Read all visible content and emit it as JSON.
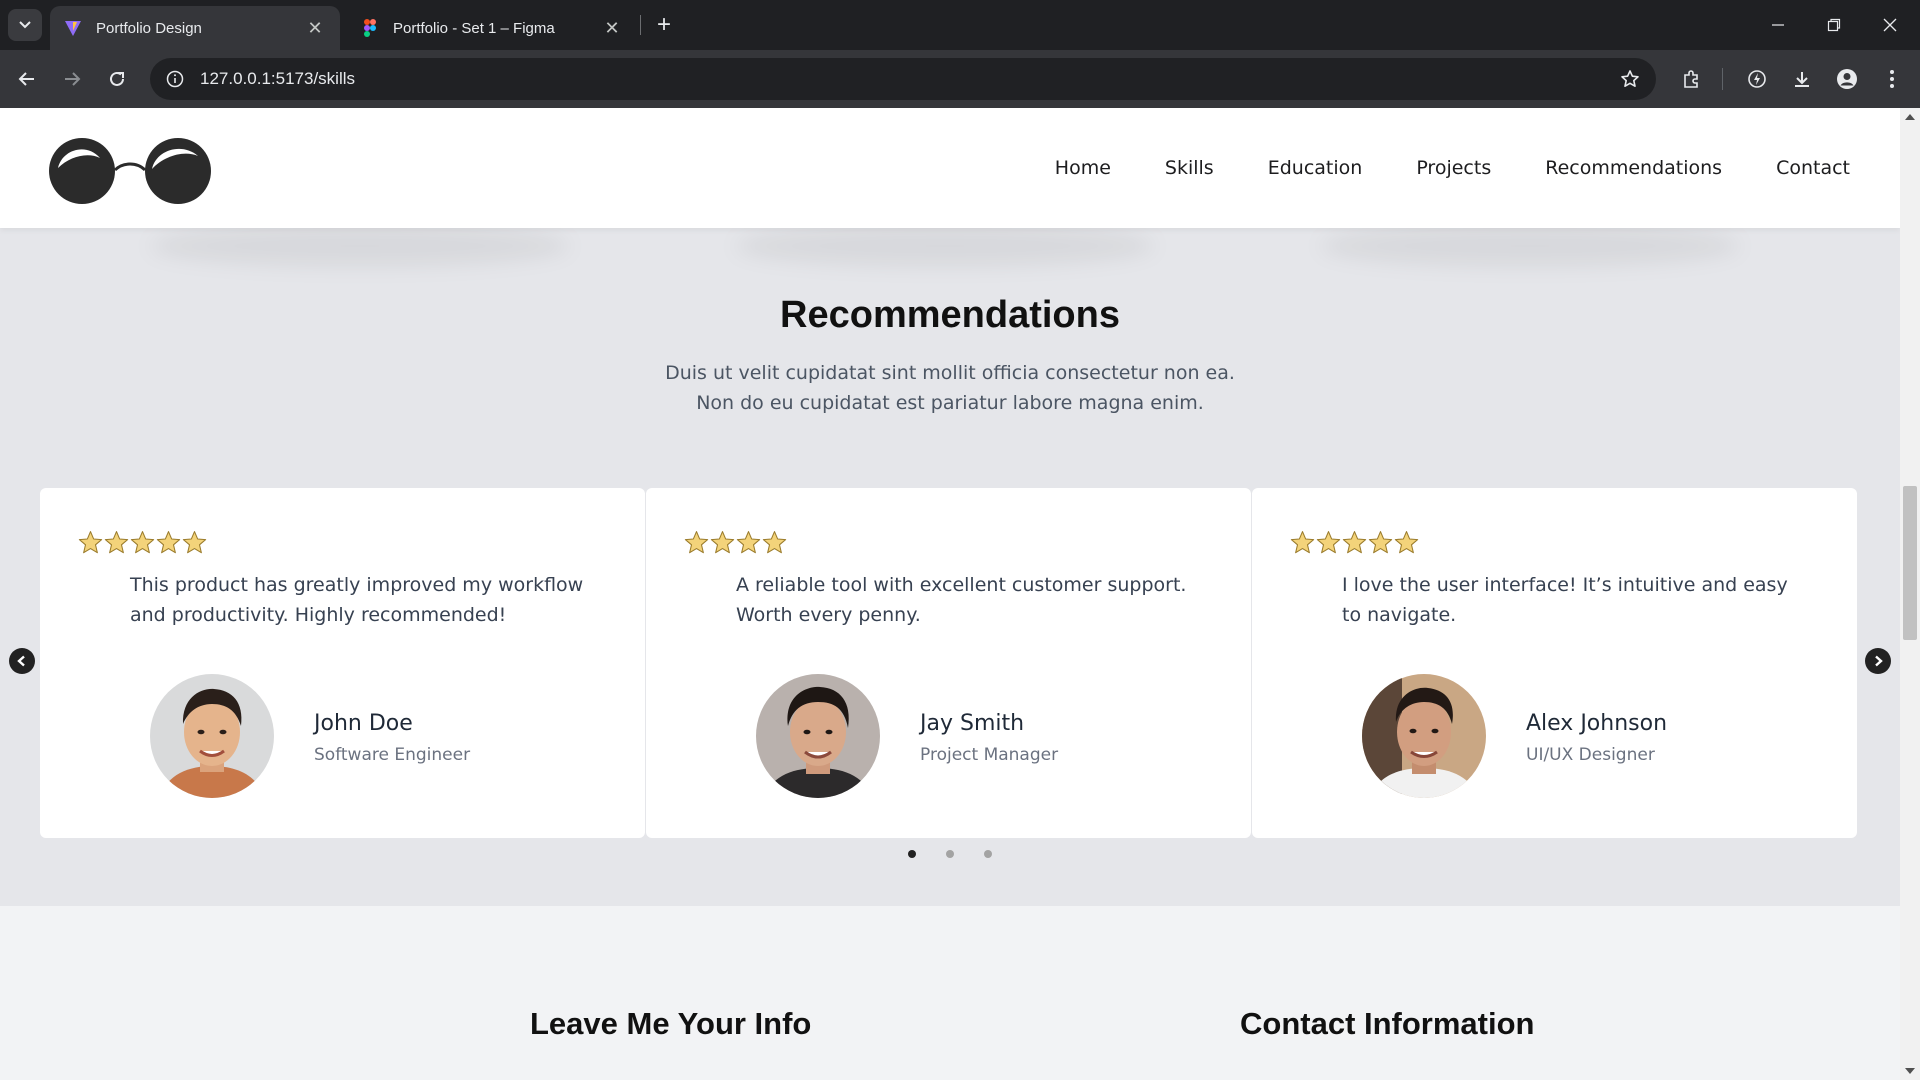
{
  "browser": {
    "tabs": [
      {
        "title": "Portfolio Design",
        "active": true
      },
      {
        "title": "Portfolio - Set 1 – Figma",
        "active": false
      }
    ],
    "url": "127.0.0.1:5173/skills"
  },
  "site": {
    "nav": [
      "Home",
      "Skills",
      "Education",
      "Projects",
      "Recommendations",
      "Contact"
    ],
    "recommendations": {
      "title": "Recommendations",
      "subtitle_line1": "Duis ut velit cupidatat sint mollit officia consectetur non ea.",
      "subtitle_line2": "Non do eu cupidatat est pariatur labore magna enim.",
      "cards": [
        {
          "rating": 5,
          "quote": "This product has greatly improved my workflow and productivity. Highly recommended!",
          "name": "John Doe",
          "role": "Software Engineer"
        },
        {
          "rating": 4,
          "quote": "A reliable tool with excellent customer support. Worth every penny.",
          "name": "Jay Smith",
          "role": "Project Manager"
        },
        {
          "rating": 5,
          "quote": "I love the user interface! It’s intuitive and easy to navigate.",
          "name": "Alex Johnson",
          "role": "UI/UX Designer"
        }
      ],
      "active_page": 1,
      "page_count": 3
    },
    "contact": {
      "left_title": "Leave Me Your Info",
      "right_title": "Contact Information"
    }
  },
  "colors": {
    "star_fill": "#f3d37a",
    "star_stroke": "#9a7b2b",
    "page_bg": "#e5e6ea"
  },
  "icons": [
    "tab-search-icon",
    "vite-favicon-icon",
    "figma-favicon-icon",
    "close-icon",
    "plus-icon",
    "minimize-icon",
    "restore-icon",
    "window-close-icon",
    "back-icon",
    "forward-icon",
    "reload-icon",
    "site-info-icon",
    "bookmark-star-icon",
    "extensions-icon",
    "performance-icon",
    "download-icon",
    "profile-icon",
    "kebab-menu-icon",
    "glasses-logo-icon",
    "star-icon",
    "chevron-left-icon",
    "chevron-right-icon"
  ]
}
